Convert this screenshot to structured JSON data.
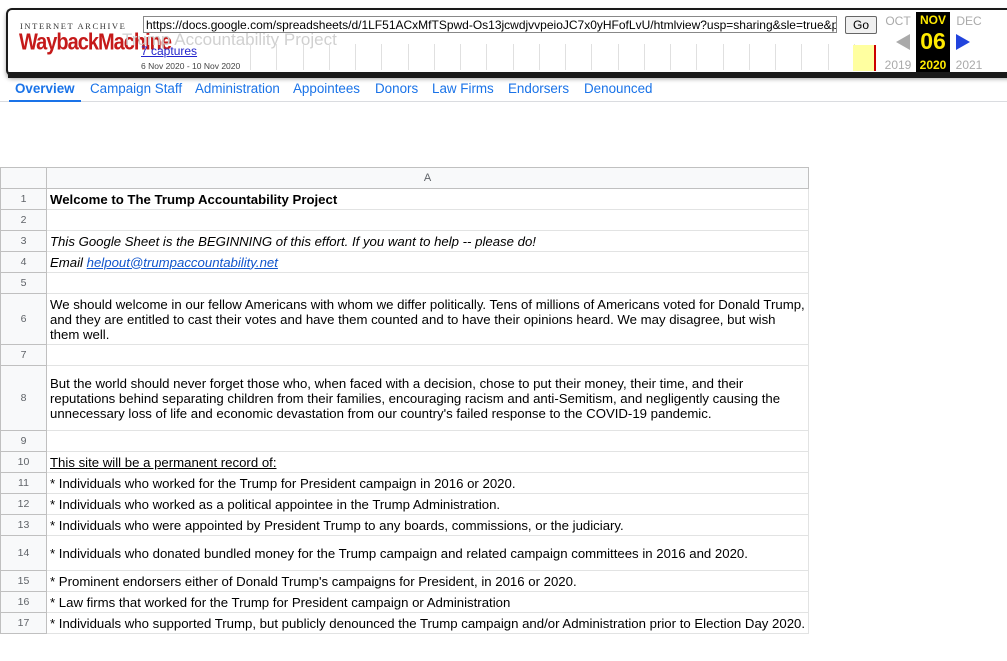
{
  "wayback": {
    "logo_top": "INTERNET ARCHIVE",
    "logo": "WaybackMachine",
    "url": "https://docs.google.com/spreadsheets/d/1LF51ACxMfTSpwd-Os13jcwdjvvpeioJC7x0yHFofLvU/htmlview?usp=sharing&sle=true&p",
    "go_label": "Go",
    "ghost_title": "Trump Accountability Project",
    "captures_label": "7 captures",
    "date_range": "6 Nov 2020 - 10 Nov 2020",
    "prev_month": "OCT",
    "prev_year": "2019",
    "current_month": "NOV",
    "current_day": "06",
    "current_year": "2020",
    "next_month": "DEC",
    "next_year": "2021"
  },
  "tabs": [
    {
      "label": "Overview",
      "active": true
    },
    {
      "label": "Campaign Staff",
      "active": false
    },
    {
      "label": "Administration",
      "active": false
    },
    {
      "label": "Appointees",
      "active": false
    },
    {
      "label": "Donors",
      "active": false
    },
    {
      "label": "Law Firms",
      "active": false
    },
    {
      "label": "Endorsers",
      "active": false
    },
    {
      "label": "Denounced",
      "active": false
    }
  ],
  "sheet": {
    "column_header": "A",
    "rows": [
      {
        "num": "1",
        "text": "Welcome to The Trump Accountability Project",
        "style": "bold"
      },
      {
        "num": "2",
        "text": ""
      },
      {
        "num": "3",
        "text": "This Google Sheet is the BEGINNING of this effort. If you want to help -- please do!",
        "style": "italic"
      },
      {
        "num": "4",
        "prefix": "Email ",
        "link": "helpout@trumpaccountability.net",
        "style": "italic"
      },
      {
        "num": "5",
        "text": ""
      },
      {
        "num": "6",
        "text": "We should welcome in our fellow Americans with whom we differ politically. Tens of millions of Americans voted for Donald Trump, and they are entitled to cast their votes and have them counted and to have their opinions heard. We may disagree, but wish them well."
      },
      {
        "num": "7",
        "text": ""
      },
      {
        "num": "8",
        "text": "But the world should never forget those who, when faced with a decision, chose to put their money, their time, and their reputations behind separating children from their families, encouraging racism and anti-Semitism, and negligently causing the unnecessary loss of life and economic devastation from our country's failed response to the COVID-19 pandemic."
      },
      {
        "num": "9",
        "text": ""
      },
      {
        "num": "10",
        "text": "This site will be a permanent record of:",
        "style": "under"
      },
      {
        "num": "11",
        "text": "* Individuals who worked for the Trump for President campaign in 2016 or 2020."
      },
      {
        "num": "12",
        "text": "* Individuals who worked as a political appointee in the Trump Administration."
      },
      {
        "num": "13",
        "text": "* Individuals who were appointed by President Trump to any boards, commissions, or the judiciary."
      },
      {
        "num": "14",
        "text": "* Individuals who donated bundled money for the Trump campaign and related campaign committees in 2016 and 2020."
      },
      {
        "num": "15",
        "text": "* Prominent endorsers either of Donald Trump's campaigns for President, in 2016 or 2020."
      },
      {
        "num": "16",
        "text": "* Law firms that worked for the Trump for President campaign or Administration"
      },
      {
        "num": "17",
        "text": "* Individuals who supported Trump, but publicly denounced the Trump campaign and/or Administration prior to Election Day 2020.",
        "style": "nowrap"
      }
    ]
  }
}
